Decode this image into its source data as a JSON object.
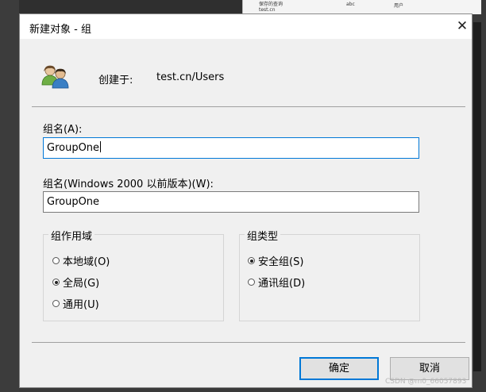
{
  "dialog": {
    "title": "新建对象 - 组",
    "close_glyph": "✕",
    "created_in_label": "创建于:",
    "created_in_value": "test.cn/Users",
    "icon": "group-icon"
  },
  "form": {
    "group_name_label": "组名(A):",
    "group_name_value": "GroupOne",
    "pre2000_label": "组名(Windows 2000 以前版本)(W):",
    "pre2000_value": "GroupOne"
  },
  "scope": {
    "legend": "组作用域",
    "options": [
      {
        "label": "本地域(O)",
        "selected": false
      },
      {
        "label": "全局(G)",
        "selected": true
      },
      {
        "label": "通用(U)",
        "selected": false
      }
    ]
  },
  "type": {
    "legend": "组类型",
    "options": [
      {
        "label": "安全组(S)",
        "selected": true
      },
      {
        "label": "通讯组(D)",
        "selected": false
      }
    ]
  },
  "buttons": {
    "ok": "确定",
    "cancel": "取消"
  },
  "background": {
    "item1": "保存的查询",
    "item2": "test.cn",
    "item3": "abc",
    "item4": "用户"
  },
  "watermark": "CSDN @m0_66057893"
}
